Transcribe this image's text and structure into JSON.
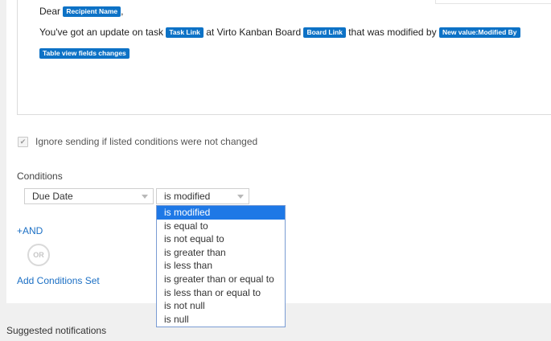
{
  "editor": {
    "line1_prefix": "Dear",
    "recipient_token": "Recipient Name",
    "line1_suffix": ",",
    "line2_part1": "You've got an update on task",
    "task_token": "Task Link",
    "line2_part2": "at Virto Kanban Board",
    "board_token": "Board Link",
    "line2_part3": "that was modified by",
    "modified_by_token": "New value:Modified By",
    "table_changes_token": "Table view fields changes"
  },
  "ignore_checkbox": {
    "label": "Ignore sending if listed conditions were not changed",
    "checked": true
  },
  "conditions": {
    "title": "Conditions",
    "field_select": "Due Date",
    "operator_select": "is modified",
    "operator_options": [
      "is modified",
      "is equal to",
      "is not equal to",
      "is greater than",
      "is less than",
      "is greater than or equal to",
      "is less than or equal to",
      "is not null",
      "is null"
    ],
    "selected_index": 0,
    "and_link": "+AND",
    "or_label": "OR",
    "add_set_link": "Add Conditions Set"
  },
  "suggested": {
    "title": "Suggested notifications"
  }
}
